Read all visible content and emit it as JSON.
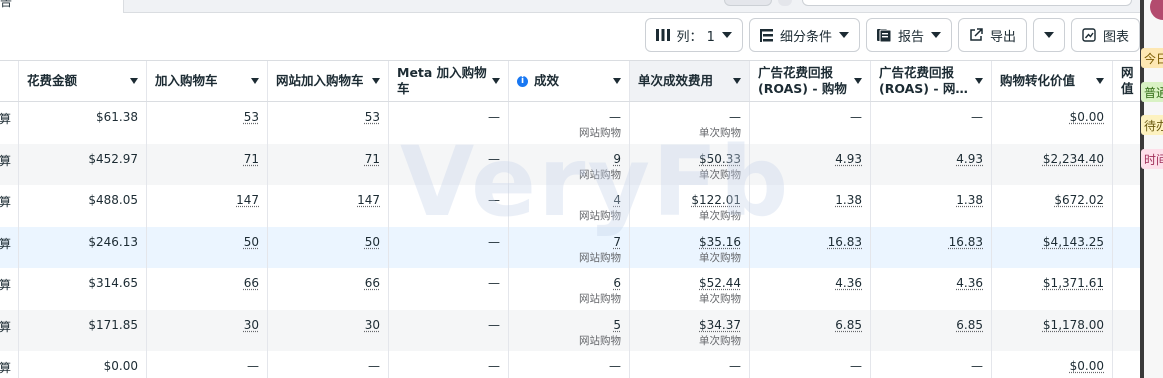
{
  "top_tab_fragment": "告",
  "toolbar": {
    "columns_label": "列：",
    "columns_count": "1",
    "breakdown_label": "细分条件",
    "reports_label": "报告",
    "export_label": "导出",
    "charts_label": "图表"
  },
  "columns": [
    {
      "label": ""
    },
    {
      "label": "花费金额"
    },
    {
      "label": "加入购物车"
    },
    {
      "label": "网站加入购物车"
    },
    {
      "label": "Meta 加入购物车"
    },
    {
      "label": "成效"
    },
    {
      "label": "单次成效费用"
    },
    {
      "label": "广告花费回报 (ROAS) - 购物"
    },
    {
      "label": "广告花费回报 (ROAS) - 网…"
    },
    {
      "label": "购物转化价值"
    },
    {
      "label": "网 值"
    }
  ],
  "rows": [
    {
      "lead": "算",
      "spend": "$61.38",
      "atc": "53",
      "web_atc": "53",
      "meta_atc": "—",
      "results": "—",
      "results_sub": "网站购物",
      "cpr": "—",
      "cpr_sub": "单次购物",
      "roas_p": "—",
      "roas_w": "—",
      "value": "$0.00"
    },
    {
      "lead": "算",
      "spend": "$452.97",
      "atc": "71",
      "web_atc": "71",
      "meta_atc": "—",
      "results": "9",
      "results_sub": "网站购物",
      "cpr": "$50.33",
      "cpr_sub": "单次购物",
      "roas_p": "4.93",
      "roas_w": "4.93",
      "value": "$2,234.40"
    },
    {
      "lead": "算",
      "spend": "$488.05",
      "atc": "147",
      "web_atc": "147",
      "meta_atc": "—",
      "results": "4",
      "results_sub": "网站购物",
      "cpr": "$122.01",
      "cpr_sub": "单次购物",
      "roas_p": "1.38",
      "roas_w": "1.38",
      "value": "$672.02"
    },
    {
      "lead": "算",
      "spend": "$246.13",
      "atc": "50",
      "web_atc": "50",
      "meta_atc": "—",
      "results": "7",
      "results_sub": "网站购物",
      "cpr": "$35.16",
      "cpr_sub": "单次购物",
      "roas_p": "16.83",
      "roas_w": "16.83",
      "value": "$4,143.25"
    },
    {
      "lead": "算",
      "spend": "$314.65",
      "atc": "66",
      "web_atc": "66",
      "meta_atc": "—",
      "results": "6",
      "results_sub": "网站购物",
      "cpr": "$52.44",
      "cpr_sub": "单次购物",
      "roas_p": "4.36",
      "roas_w": "4.36",
      "value": "$1,371.61"
    },
    {
      "lead": "算",
      "spend": "$171.85",
      "atc": "30",
      "web_atc": "30",
      "meta_atc": "—",
      "results": "5",
      "results_sub": "网站购物",
      "cpr": "$34.37",
      "cpr_sub": "单次购物",
      "roas_p": "6.85",
      "roas_w": "6.85",
      "value": "$1,178.00"
    },
    {
      "lead": "算",
      "spend": "$0.00",
      "atc": "—",
      "web_atc": "—",
      "meta_atc": "—",
      "results": "—",
      "results_sub": "",
      "cpr": "—",
      "cpr_sub": "",
      "roas_p": "—",
      "roas_w": "—",
      "value": "$0.00"
    }
  ],
  "watermark": "VeryFb",
  "side_notes": [
    "今日",
    "普通",
    "待办w",
    "时间"
  ],
  "colors": {
    "accent": "#1877f2",
    "row_highlight": "#ebf5ff",
    "sorted_header": "#f0f2f5"
  },
  "icons": [
    "columns-icon",
    "breakdown-icon",
    "reports-icon",
    "export-icon",
    "more-caret-icon",
    "chart-icon",
    "info-icon"
  ]
}
